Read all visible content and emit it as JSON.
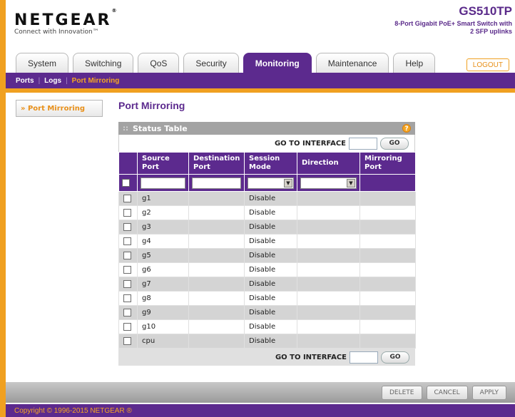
{
  "brand": {
    "logo": "NETGEAR",
    "tm": "®",
    "tagline": "Connect with Innovation™"
  },
  "model": {
    "name": "GS510TP",
    "desc": "8-Port Gigabit PoE+ Smart Switch with 2 SFP uplinks"
  },
  "tabs": [
    {
      "label": "System"
    },
    {
      "label": "Switching"
    },
    {
      "label": "QoS"
    },
    {
      "label": "Security"
    },
    {
      "label": "Monitoring",
      "active": true
    },
    {
      "label": "Maintenance"
    },
    {
      "label": "Help"
    }
  ],
  "logout_label": "LOGOUT",
  "subnav": {
    "ports": "Ports",
    "logs": "Logs",
    "mirroring": "Port Mirroring",
    "sep": "|"
  },
  "side_menu": {
    "item": "» Port Mirroring"
  },
  "page_title": "Port Mirroring",
  "panel": {
    "title": "Status Table",
    "dots": "::",
    "help": "?",
    "goto_label": "GO TO INTERFACE",
    "go_label": "GO",
    "columns": [
      "Source Port",
      "Destination Port",
      "Session Mode",
      "Direction",
      "Mirroring Port"
    ],
    "rows": [
      {
        "source": "g1",
        "dest": "",
        "mode": "Disable",
        "dir": "",
        "mport": ""
      },
      {
        "source": "g2",
        "dest": "",
        "mode": "Disable",
        "dir": "",
        "mport": ""
      },
      {
        "source": "g3",
        "dest": "",
        "mode": "Disable",
        "dir": "",
        "mport": ""
      },
      {
        "source": "g4",
        "dest": "",
        "mode": "Disable",
        "dir": "",
        "mport": ""
      },
      {
        "source": "g5",
        "dest": "",
        "mode": "Disable",
        "dir": "",
        "mport": ""
      },
      {
        "source": "g6",
        "dest": "",
        "mode": "Disable",
        "dir": "",
        "mport": ""
      },
      {
        "source": "g7",
        "dest": "",
        "mode": "Disable",
        "dir": "",
        "mport": ""
      },
      {
        "source": "g8",
        "dest": "",
        "mode": "Disable",
        "dir": "",
        "mport": ""
      },
      {
        "source": "g9",
        "dest": "",
        "mode": "Disable",
        "dir": "",
        "mport": ""
      },
      {
        "source": "g10",
        "dest": "",
        "mode": "Disable",
        "dir": "",
        "mport": ""
      },
      {
        "source": "cpu",
        "dest": "",
        "mode": "Disable",
        "dir": "",
        "mport": ""
      }
    ]
  },
  "actions": {
    "delete": "DELETE",
    "cancel": "CANCEL",
    "apply": "APPLY"
  },
  "footer": "Copyright © 1996-2015 NETGEAR ®",
  "colors": {
    "purple": "#5c2a8e",
    "orange": "#f0a020"
  }
}
